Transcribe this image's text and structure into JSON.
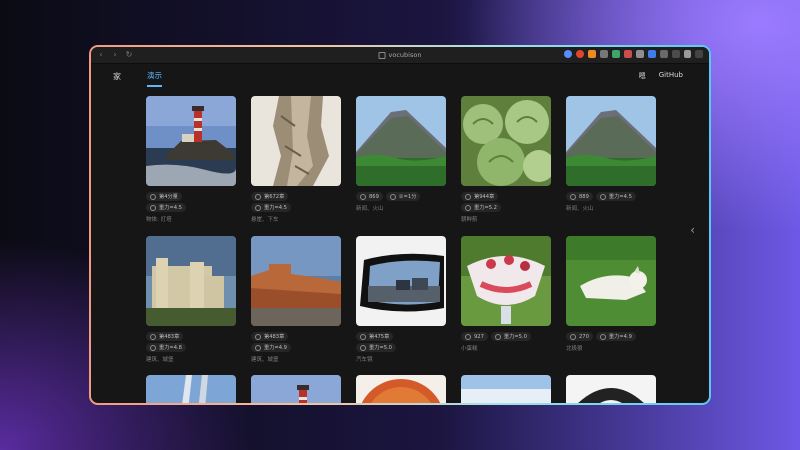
{
  "browser": {
    "url": "vocubison",
    "nav": [
      "‹",
      "›",
      "↻"
    ]
  },
  "topnav": {
    "home": "家",
    "tab": "演示",
    "right": [
      "嗯",
      "GitHub"
    ]
  },
  "cards": [
    {
      "thumb": "lighthouse",
      "badge": "第4分量",
      "score": "重力=4.5",
      "tag": "物体: 灯塔"
    },
    {
      "thumb": "cliff",
      "badge": "第672章",
      "score": "重力=4.5",
      "tag": "悬崖、下车"
    },
    {
      "thumb": "volcano",
      "badge": "869",
      "score": "①=1分",
      "tag": "新闻、火山"
    },
    {
      "thumb": "artichoke",
      "badge": "第944章",
      "score": "重力=5.2",
      "tag": "朝鲜蓟"
    },
    {
      "thumb": "volcano",
      "badge": "889",
      "score": "重力=4.5",
      "tag": "新闻、火山"
    },
    {
      "thumb": "castle",
      "badge": "第483章",
      "score": "重力=4.8",
      "tag": "建筑、城堡"
    },
    {
      "thumb": "fort",
      "badge": "第483章",
      "score": "重力=4.9",
      "tag": "建筑、城堡"
    },
    {
      "thumb": "mirror",
      "badge": "第475章",
      "score": "重力=5.0",
      "tag": "汽车镜"
    },
    {
      "thumb": "trifle",
      "badge": "927",
      "score": "重力=5.0",
      "tag": "小蛋糕"
    },
    {
      "thumb": "wolf",
      "badge": "270",
      "score": "重力=4.9",
      "tag": "北极狼"
    },
    {
      "thumb": "bridge",
      "badge": "",
      "score": "",
      "tag": ""
    },
    {
      "thumb": "lighthouse",
      "badge": "",
      "score": "",
      "tag": ""
    },
    {
      "thumb": "pizza",
      "badge": "",
      "score": "",
      "tag": ""
    },
    {
      "thumb": "sky",
      "badge": "",
      "score": "",
      "tag": ""
    },
    {
      "thumb": "arch",
      "badge": "",
      "score": "",
      "tag": ""
    }
  ],
  "chevron": "‹",
  "colors": {
    "accent": "#5fb6ff",
    "panel": "#161616",
    "pill": "#262626"
  }
}
